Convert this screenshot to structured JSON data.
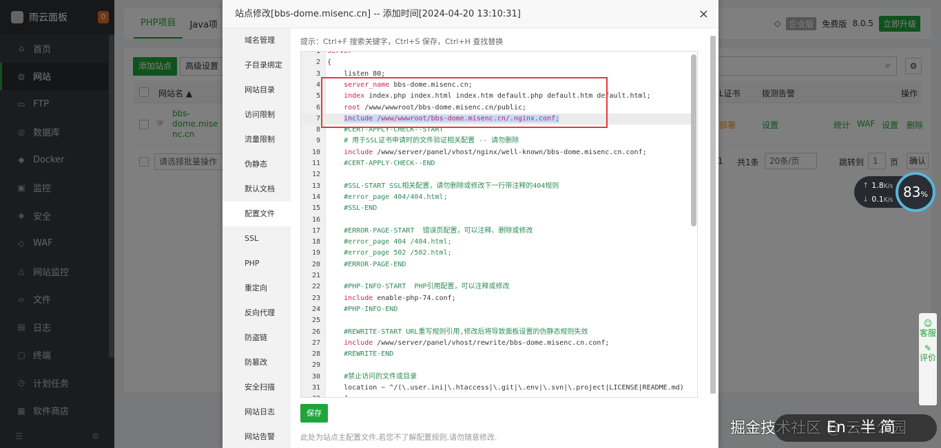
{
  "sidebar": {
    "brand": "雨云面板",
    "badge": "0",
    "items": [
      {
        "label": "首页",
        "icon": "home-icon",
        "glyph": "⌂"
      },
      {
        "label": "网站",
        "icon": "globe-icon",
        "glyph": "◍"
      },
      {
        "label": "FTP",
        "icon": "ftp-icon",
        "glyph": "▭"
      },
      {
        "label": "数据库",
        "icon": "database-icon",
        "glyph": "◎"
      },
      {
        "label": "Docker",
        "icon": "docker-icon",
        "glyph": "◆"
      },
      {
        "label": "监控",
        "icon": "monitor-icon",
        "glyph": "▣"
      },
      {
        "label": "安全",
        "icon": "shield-icon",
        "glyph": "◈"
      },
      {
        "label": "WAF",
        "icon": "waf-icon",
        "glyph": "◇"
      },
      {
        "label": "网站监控",
        "icon": "chart-icon",
        "glyph": "△"
      },
      {
        "label": "文件",
        "icon": "folder-icon",
        "glyph": "▱"
      },
      {
        "label": "日志",
        "icon": "log-icon",
        "glyph": "▤"
      },
      {
        "label": "终端",
        "icon": "terminal-icon",
        "glyph": "▢"
      },
      {
        "label": "计划任务",
        "icon": "clock-icon",
        "glyph": "◷"
      },
      {
        "label": "软件商店",
        "icon": "store-icon",
        "glyph": "▦"
      }
    ],
    "active_index": 1
  },
  "background": {
    "tabs": [
      "PHP项目",
      "Java项"
    ],
    "enterprise": "企业版",
    "free": "免费版",
    "version": "8.0.5",
    "upgrade": "立即升级",
    "add_site": "添加站点",
    "advanced": "高级设置",
    "col_name": "网站名 ▲",
    "col_ssl": "L证书",
    "col_alarm": "拨测告警",
    "col_ops": "操作",
    "row_name": [
      "bbs-",
      "dome.mise",
      "nc.cn"
    ],
    "row_ssl": "部署",
    "row_alarm": "设置",
    "row_ops": [
      "统计",
      "WAF",
      "设置",
      "删除"
    ],
    "batch_placeholder": "请选择批量操作",
    "page_current": "1",
    "total": "共1条",
    "per_page": "20条/页",
    "jump": "跳转到",
    "jump_value": "1",
    "page_unit": "页",
    "confirm": "确认"
  },
  "speed": {
    "up": "1.8",
    "down": "0.1",
    "unit": "K/s",
    "load": "83",
    "load_unit": "%"
  },
  "service": {
    "a": "客服",
    "b": "评价"
  },
  "watermark": "掘金技术社区 @ 云上公园",
  "watermark_ime": "En · 半 简",
  "modal": {
    "title": "站点修改[bbs-dome.misenc.cn] -- 添加时间[2024-04-20 13:10:31]",
    "close": "×",
    "tabs": [
      "域名管理",
      "子目录绑定",
      "网站目录",
      "访问限制",
      "流量限制",
      "伪静态",
      "默认文档",
      "配置文件",
      "SSL",
      "PHP",
      "重定向",
      "反向代理",
      "防盗链",
      "防篡改",
      "安全扫描",
      "网站日志",
      "网站告警"
    ],
    "active_tab": 7,
    "tip": "提示：Ctrl+F 搜索关键字，Ctrl+S 保存，Ctrl+H 查找替换",
    "save": "保存",
    "note": "此处为站点主配置文件,若您不了解配置规则,请勿随意修改.",
    "lines": [
      {
        "n": "1",
        "parts": [
          {
            "t": "server",
            "c": "kw"
          }
        ]
      },
      {
        "n": "2",
        "parts": [
          {
            "t": "{",
            "c": ""
          }
        ]
      },
      {
        "n": "3",
        "parts": [
          {
            "t": "    listen 80;",
            "c": ""
          }
        ]
      },
      {
        "n": "4",
        "parts": [
          {
            "t": "    ",
            "c": ""
          },
          {
            "t": "server_name",
            "c": "kw"
          },
          {
            "t": " bbs-dome.misenc.cn;",
            "c": ""
          }
        ]
      },
      {
        "n": "5",
        "parts": [
          {
            "t": "    ",
            "c": ""
          },
          {
            "t": "index",
            "c": "kw"
          },
          {
            "t": " index.php index.html index.htm default.php default.htm default.html;",
            "c": ""
          }
        ]
      },
      {
        "n": "6",
        "parts": [
          {
            "t": "    ",
            "c": ""
          },
          {
            "t": "root",
            "c": "kw"
          },
          {
            "t": " /www/wwwroot/bbs-dome.misenc.cn/public;",
            "c": ""
          }
        ]
      },
      {
        "n": "7",
        "parts": [
          {
            "t": "    ",
            "c": ""
          },
          {
            "t": "include /www/wwwroot/bbs-dome.misenc.cn/.nginx.conf;",
            "c": "kw hl"
          }
        ]
      },
      {
        "n": "8",
        "parts": [
          {
            "t": "    #CERT-APPLY-CHECK--START",
            "c": "cm"
          }
        ]
      },
      {
        "n": "9",
        "parts": [
          {
            "t": "    # 用于SSL证书申请时的文件验证相关配置 -- 请勿删除",
            "c": "cm"
          }
        ]
      },
      {
        "n": "10",
        "parts": [
          {
            "t": "    ",
            "c": ""
          },
          {
            "t": "include",
            "c": "kw"
          },
          {
            "t": " /www/server/panel/vhost/nginx/well-known/bbs-dome.misenc.cn.conf;",
            "c": ""
          }
        ]
      },
      {
        "n": "11",
        "parts": [
          {
            "t": "    #CERT-APPLY-CHECK--END",
            "c": "cm"
          }
        ]
      },
      {
        "n": "12",
        "parts": [
          {
            "t": "",
            "c": ""
          }
        ]
      },
      {
        "n": "13",
        "parts": [
          {
            "t": "    #SSL-START SSL相关配置，请勿删除或修改下一行带注释的404规则",
            "c": "cm"
          }
        ]
      },
      {
        "n": "14",
        "parts": [
          {
            "t": "    #error_page 404/404.html;",
            "c": "cm"
          }
        ]
      },
      {
        "n": "15",
        "parts": [
          {
            "t": "    #SSL-END",
            "c": "cm"
          }
        ]
      },
      {
        "n": "16",
        "parts": [
          {
            "t": "",
            "c": ""
          }
        ]
      },
      {
        "n": "17",
        "parts": [
          {
            "t": "    #ERROR-PAGE-START  错误页配置，可以注释、删除或修改",
            "c": "cm"
          }
        ]
      },
      {
        "n": "18",
        "parts": [
          {
            "t": "    #error_page 404 /404.html;",
            "c": "cm"
          }
        ]
      },
      {
        "n": "19",
        "parts": [
          {
            "t": "    #error_page 502 /502.html;",
            "c": "cm"
          }
        ]
      },
      {
        "n": "20",
        "parts": [
          {
            "t": "    #ERROR-PAGE-END",
            "c": "cm"
          }
        ]
      },
      {
        "n": "21",
        "parts": [
          {
            "t": "",
            "c": ""
          }
        ]
      },
      {
        "n": "22",
        "parts": [
          {
            "t": "    #PHP-INFO-START  PHP引用配置，可以注释或修改",
            "c": "cm"
          }
        ]
      },
      {
        "n": "23",
        "parts": [
          {
            "t": "    ",
            "c": ""
          },
          {
            "t": "include",
            "c": "kw"
          },
          {
            "t": " enable-php-74.conf;",
            "c": ""
          }
        ]
      },
      {
        "n": "24",
        "parts": [
          {
            "t": "    #PHP-INFO-END",
            "c": "cm"
          }
        ]
      },
      {
        "n": "25",
        "parts": [
          {
            "t": "",
            "c": ""
          }
        ]
      },
      {
        "n": "26",
        "parts": [
          {
            "t": "    #REWRITE-START URL重写规则引用,修改后将导致面板设置的伪静态规则失效",
            "c": "cm"
          }
        ]
      },
      {
        "n": "27",
        "parts": [
          {
            "t": "    ",
            "c": ""
          },
          {
            "t": "include",
            "c": "kw"
          },
          {
            "t": " /www/server/panel/vhost/rewrite/bbs-dome.misenc.cn.conf;",
            "c": ""
          }
        ]
      },
      {
        "n": "28",
        "parts": [
          {
            "t": "    #REWRITE-END",
            "c": "cm"
          }
        ]
      },
      {
        "n": "29",
        "parts": [
          {
            "t": "",
            "c": ""
          }
        ]
      },
      {
        "n": "30",
        "parts": [
          {
            "t": "    #禁止访问的文件或目录",
            "c": "cm"
          }
        ]
      },
      {
        "n": "31",
        "parts": [
          {
            "t": "    location ~ ^/(\\.user.ini|\\.htaccess|\\.git|\\.env|\\.svn|\\.project|LICENSE|README.md)",
            "c": ""
          }
        ]
      },
      {
        "n": "32",
        "parts": [
          {
            "t": "    {",
            "c": ""
          }
        ]
      }
    ]
  }
}
